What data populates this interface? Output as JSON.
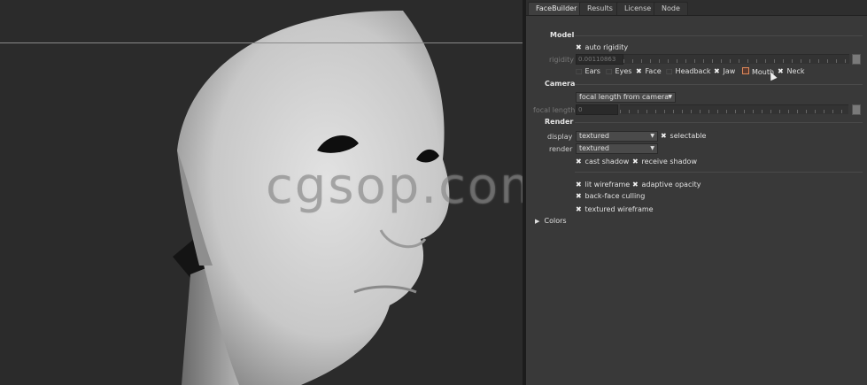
{
  "watermark": "cgsop.com",
  "tabs": [
    "FaceBuilder",
    "Results",
    "License",
    "Node"
  ],
  "model": {
    "heading": "Model",
    "auto_rigidity": "auto rigidity",
    "rigidity_label": "rigidity",
    "rigidity_value": "0.00110863",
    "parts": [
      {
        "label": "Ears",
        "checked": false
      },
      {
        "label": "Eyes",
        "checked": false
      },
      {
        "label": "Face",
        "checked": true
      },
      {
        "label": "Headback",
        "checked": false
      },
      {
        "label": "Jaw",
        "checked": true
      },
      {
        "label": "Mouth",
        "checked": false
      },
      {
        "label": "Neck",
        "checked": true
      }
    ]
  },
  "camera": {
    "heading": "Camera",
    "mode": "focal length from camera",
    "focal_label": "focal length",
    "focal_value": "0"
  },
  "render": {
    "heading": "Render",
    "display_label": "display",
    "display_value": "textured",
    "selectable": "selectable",
    "render_label": "render",
    "render_value": "textured",
    "cast_shadow": "cast shadow",
    "receive_shadow": "receive shadow",
    "lit_wireframe": "lit wireframe",
    "adaptive_opacity": "adaptive opacity",
    "backface_culling": "back-face culling",
    "textured_wireframe": "textured wireframe"
  },
  "colors": "Colors"
}
